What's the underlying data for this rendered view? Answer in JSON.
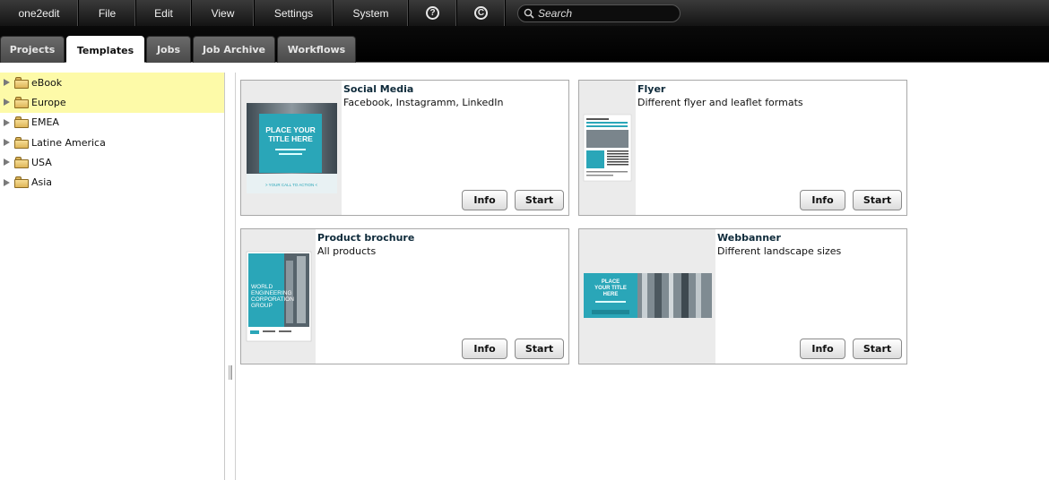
{
  "menubar": {
    "items": [
      {
        "label": "one2edit"
      },
      {
        "label": "File"
      },
      {
        "label": "Edit"
      },
      {
        "label": "View"
      },
      {
        "label": "Settings"
      },
      {
        "label": "System"
      }
    ],
    "help_glyph": "?",
    "copyright_glyph": "C",
    "search_placeholder": "Search"
  },
  "tabs": [
    {
      "label": "Projects"
    },
    {
      "label": "Templates"
    },
    {
      "label": "Jobs"
    },
    {
      "label": "Job Archive"
    },
    {
      "label": "Workflows"
    }
  ],
  "active_tab": "Templates",
  "tree": {
    "items": [
      {
        "label": "eBook"
      },
      {
        "label": "Europe"
      },
      {
        "label": "EMEA"
      },
      {
        "label": "Latine America"
      },
      {
        "label": "USA"
      },
      {
        "label": "Asia"
      }
    ]
  },
  "templates": [
    {
      "title": "Social Media",
      "description": "Facebook, Instagramm, LinkedIn",
      "thumb_text": "PLACE YOUR TITLE HERE",
      "thumb_cta": "> YOUR CALL TO ACTION <",
      "info_label": "Info",
      "start_label": "Start"
    },
    {
      "title": "Flyer",
      "description": "Different flyer and leaflet formats",
      "info_label": "Info",
      "start_label": "Start"
    },
    {
      "title": "Product brochure",
      "description": "All products",
      "thumb_text": "WORLD ENGINEERING CORPORATION GROUP",
      "info_label": "Info",
      "start_label": "Start"
    },
    {
      "title": "Webbanner",
      "description": "Different landscape sizes",
      "thumb_text": "PLACE YOUR TITLE HERE",
      "info_label": "Info",
      "start_label": "Start"
    }
  ],
  "colors": {
    "accent_teal": "#2aa6b8",
    "tree_highlight": "#fdfaa8",
    "menubar_bg": "#1a1a1a"
  }
}
